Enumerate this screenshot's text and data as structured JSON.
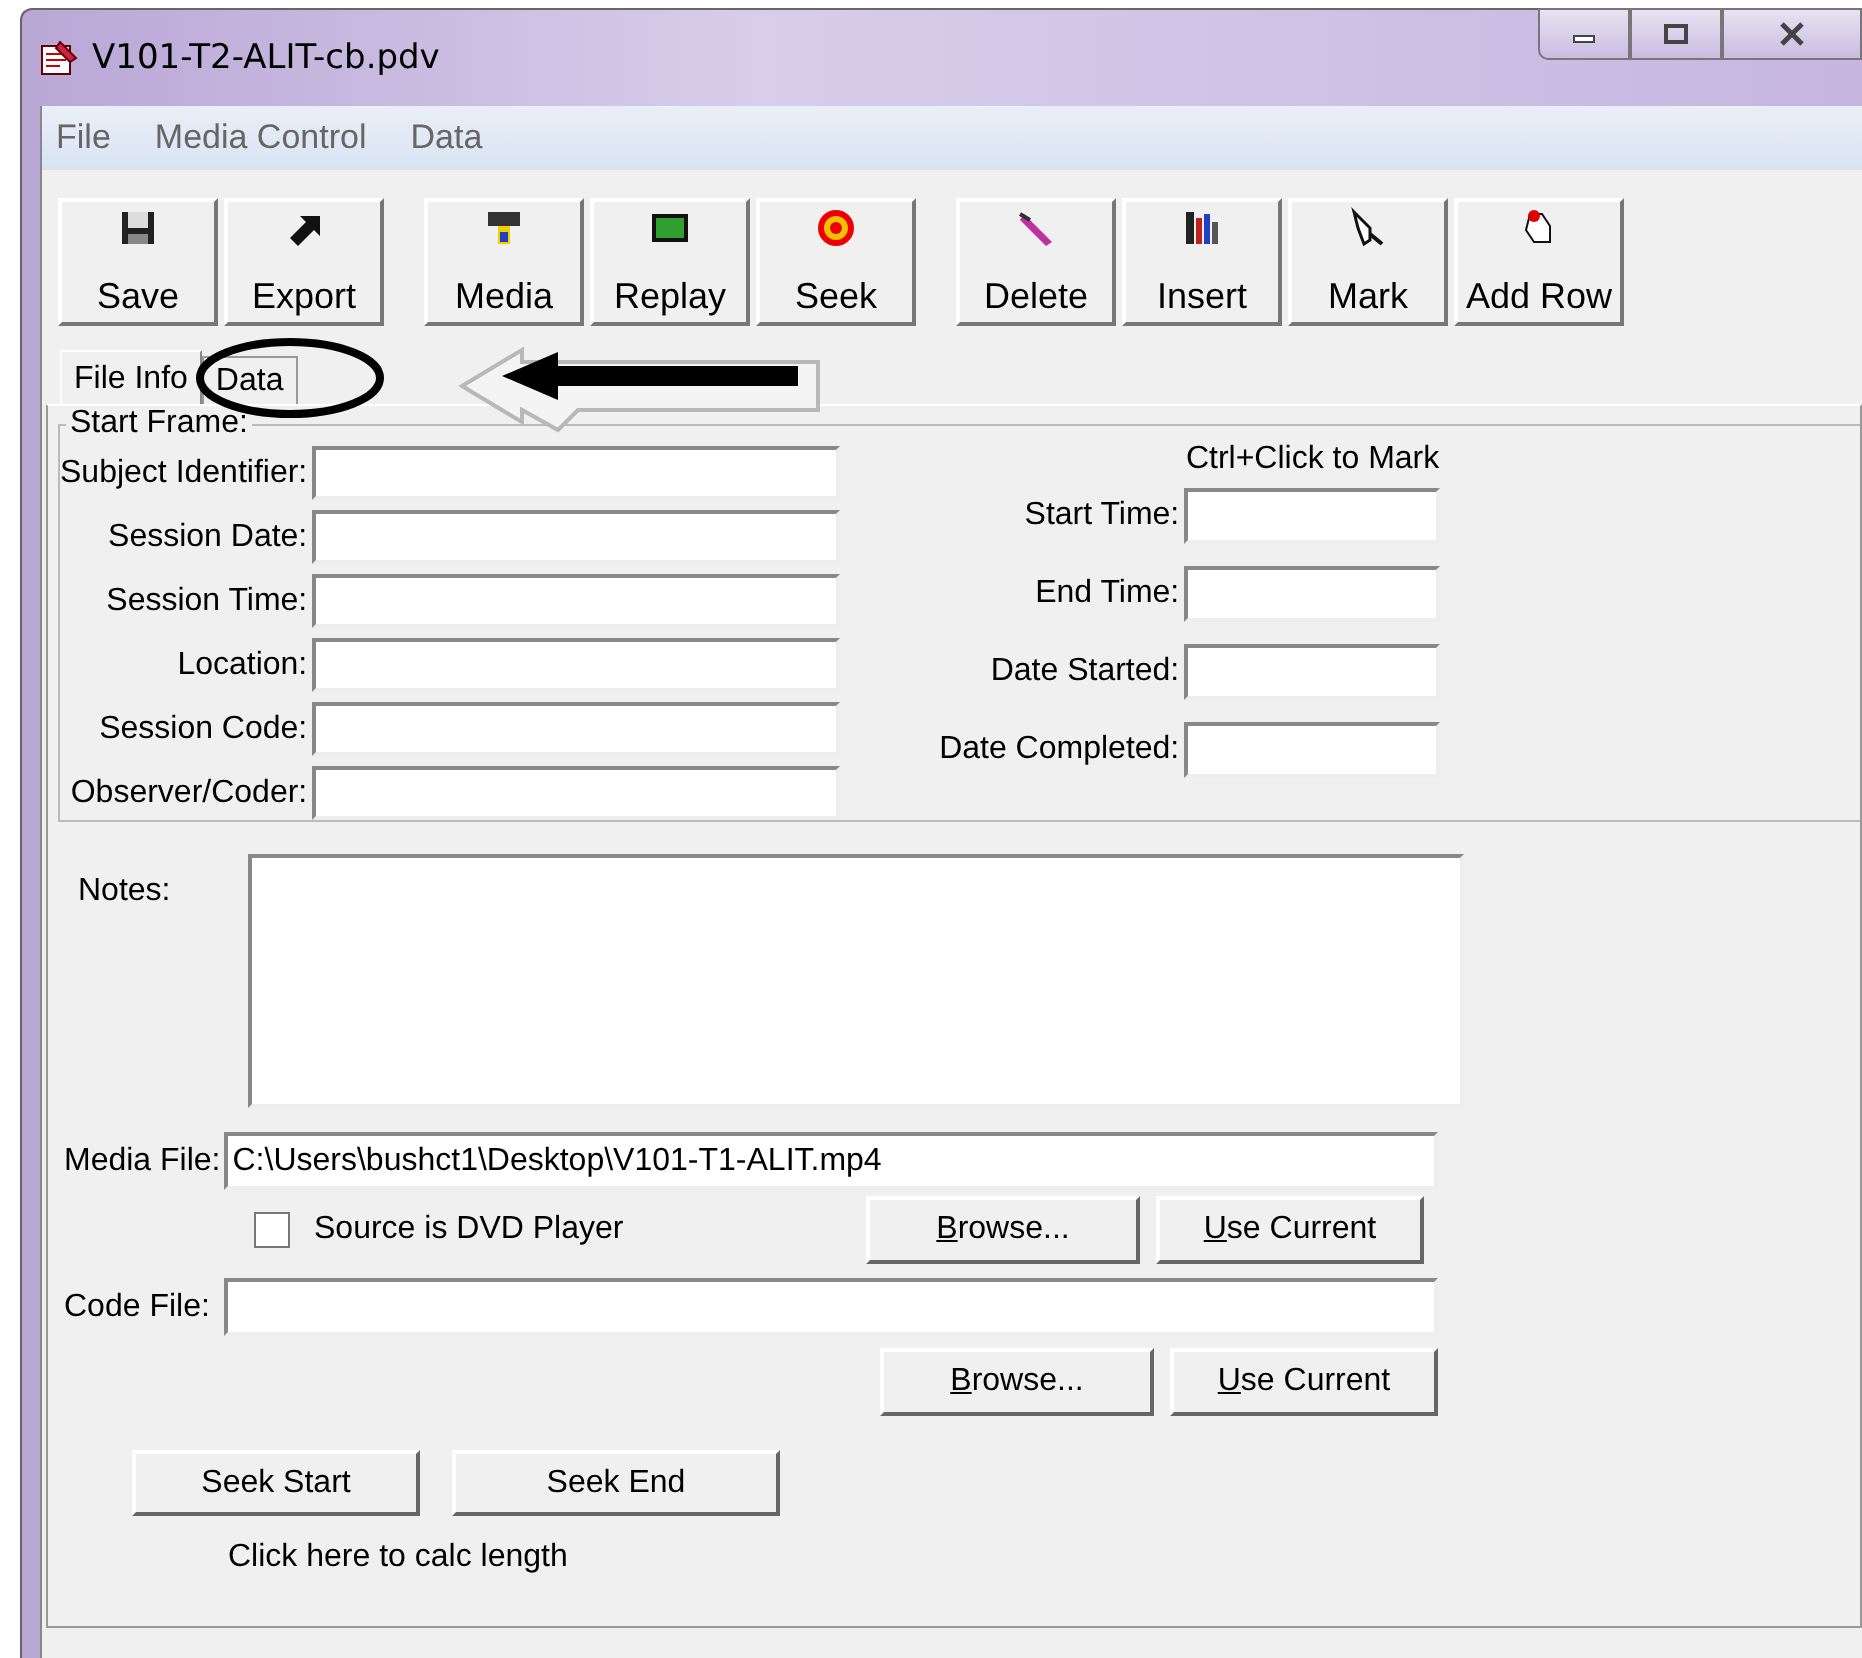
{
  "window": {
    "title": "V101-T2-ALIT-cb.pdv"
  },
  "menu": [
    {
      "label": "File"
    },
    {
      "label": "Media Control"
    },
    {
      "label": "Data"
    }
  ],
  "toolbar": [
    [
      {
        "label": "Save"
      },
      {
        "label": "Export"
      }
    ],
    [
      {
        "label": "Media"
      },
      {
        "label": "Replay"
      },
      {
        "label": "Seek"
      }
    ],
    [
      {
        "label": "Delete"
      },
      {
        "label": "Insert"
      },
      {
        "label": "Mark"
      },
      {
        "label": "Add Row"
      }
    ]
  ],
  "tabs": [
    {
      "label": "File Info",
      "selected": true
    },
    {
      "label": "Data",
      "selected": false
    }
  ],
  "start_frame": {
    "title": "Start Frame:",
    "fields": [
      {
        "label": "Subject Identifier:"
      },
      {
        "label": "Session Date:"
      },
      {
        "label": "Session Time:"
      },
      {
        "label": "Location:"
      },
      {
        "label": "Session Code:"
      },
      {
        "label": "Observer/Coder:"
      }
    ],
    "mark_hint": "Ctrl+Click to Mark",
    "time_fields": [
      {
        "label": "Start Time:"
      },
      {
        "label": "End Time:"
      },
      {
        "label": "Date Started:"
      },
      {
        "label": "Date Completed:"
      }
    ]
  },
  "notes": {
    "label": "Notes:"
  },
  "media_file": {
    "label": "Media File:",
    "value": "C:\\Users\\bushct1\\Desktop\\V101-T1-ALIT.mp4"
  },
  "dvd_source": {
    "label": "Source is DVD Player",
    "checked": false
  },
  "media_buttons": [
    {
      "label": "Browse...",
      "mnemonic": true
    },
    {
      "label": "Use Current",
      "mnemonic": true
    }
  ],
  "code_file": {
    "label": "Code File:"
  },
  "code_buttons": [
    {
      "label": "Browse...",
      "mnemonic": true
    },
    {
      "label": "Use Current",
      "mnemonic": true
    }
  ],
  "seek_buttons": [
    {
      "label": "Seek Start"
    },
    {
      "label": "Seek End"
    }
  ],
  "calc_hint": "Click here to calc length"
}
